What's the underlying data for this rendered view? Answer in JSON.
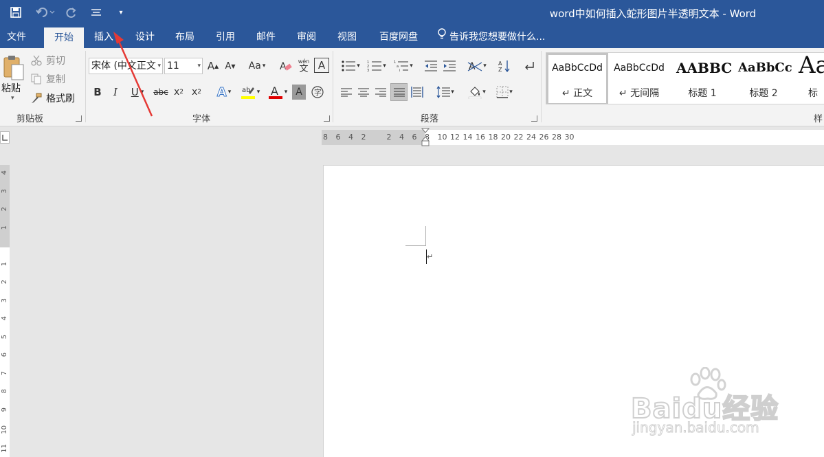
{
  "window": {
    "title": "word中如何插入蛇形图片半透明文本 - Word"
  },
  "quick_access": {
    "save_icon": "save-icon",
    "undo_icon": "undo-icon",
    "redo_icon": "redo-icon",
    "customize_icon": "customize-qat-icon"
  },
  "tabs": [
    {
      "label": "文件",
      "active": false
    },
    {
      "label": "开始",
      "active": true
    },
    {
      "label": "插入",
      "active": false
    },
    {
      "label": "设计",
      "active": false
    },
    {
      "label": "布局",
      "active": false
    },
    {
      "label": "引用",
      "active": false
    },
    {
      "label": "邮件",
      "active": false
    },
    {
      "label": "审阅",
      "active": false
    },
    {
      "label": "视图",
      "active": false
    },
    {
      "label": "百度网盘",
      "active": false
    }
  ],
  "tell_me": "告诉我您想要做什么...",
  "clipboard": {
    "paste": "粘贴",
    "cut": "剪切",
    "copy": "复制",
    "format_painter": "格式刷",
    "group_label": "剪贴板"
  },
  "font": {
    "name": "宋体 (中文正文",
    "size": "11",
    "group_label": "字体",
    "aa_label": "Aa",
    "wen": "wén",
    "wen_char": "文"
  },
  "paragraph": {
    "group_label": "段落"
  },
  "styles": {
    "items": [
      {
        "sample": "AaBbCcDd",
        "name": "↵ 正文"
      },
      {
        "sample": "AaBbCcDd",
        "name": "↵ 无间隔"
      },
      {
        "sample": "AABBC",
        "name": "标题 1"
      },
      {
        "sample": "AaBbCc",
        "name": "标题 2"
      },
      {
        "sample": "Aa",
        "name": "标"
      }
    ],
    "group_label": "样"
  },
  "ruler": {
    "h_ticks": [
      "8",
      "6",
      "4",
      "2",
      "",
      "2",
      "4",
      "6",
      "8",
      "10",
      "12",
      "14",
      "16",
      "18",
      "20",
      "22",
      "24",
      "26",
      "28",
      "30"
    ],
    "v_ticks": [
      "4",
      "3",
      "2",
      "1",
      "",
      "1",
      "2",
      "3",
      "4",
      "5",
      "6",
      "7",
      "8",
      "9",
      "10",
      "11"
    ]
  },
  "document": {
    "paragraph_mark": "↵"
  },
  "watermark": {
    "brand": "Baidu经验",
    "url": "jingyan.baidu.com"
  },
  "colors": {
    "title_bar": "#2b579a",
    "ribbon": "#f3f3f3",
    "annotation_arrow": "#e53935",
    "highlight": "#ffff00",
    "font_color": "#e00000"
  }
}
